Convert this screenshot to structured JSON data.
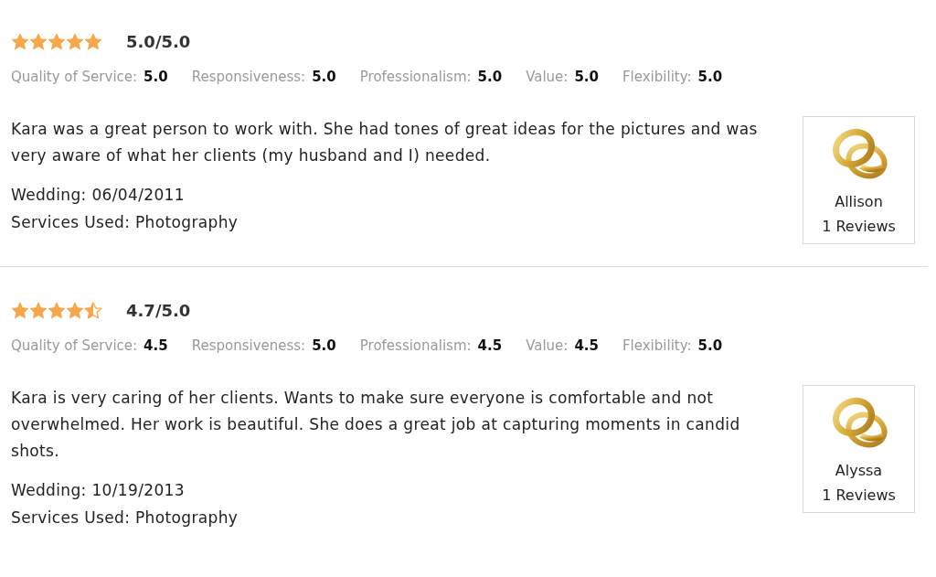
{
  "reviews": [
    {
      "stars": 5,
      "score": "5.0/5.0",
      "ratings": [
        {
          "label": "Quality of Service:",
          "value": "5.0"
        },
        {
          "label": "Responsiveness:",
          "value": "5.0"
        },
        {
          "label": "Professionalism:",
          "value": "5.0"
        },
        {
          "label": "Value:",
          "value": "5.0"
        },
        {
          "label": "Flexibility:",
          "value": "5.0"
        }
      ],
      "text": "Kara was a great person to work with. She had tones of great ideas for the pictures and was very aware of what her clients (my husband and I) needed.",
      "wedding": "Wedding: 06/04/2011",
      "services": "Services Used: Photography",
      "reviewer": {
        "name": "Allison",
        "reviews": "1 Reviews"
      }
    },
    {
      "stars": 4.5,
      "score": "4.7/5.0",
      "ratings": [
        {
          "label": "Quality of Service:",
          "value": "4.5"
        },
        {
          "label": "Responsiveness:",
          "value": "5.0"
        },
        {
          "label": "Professionalism:",
          "value": "4.5"
        },
        {
          "label": "Value:",
          "value": "4.5"
        },
        {
          "label": "Flexibility:",
          "value": "5.0"
        }
      ],
      "text": "Kara is very caring of her clients. Wants to make sure everyone is comfortable and not overwhelmed. Her work is beautiful. She does a great job at capturing moments in candid shots.",
      "wedding": "Wedding: 10/19/2013",
      "services": "Services Used: Photography",
      "reviewer": {
        "name": "Alyssa",
        "reviews": "1 Reviews"
      }
    }
  ]
}
